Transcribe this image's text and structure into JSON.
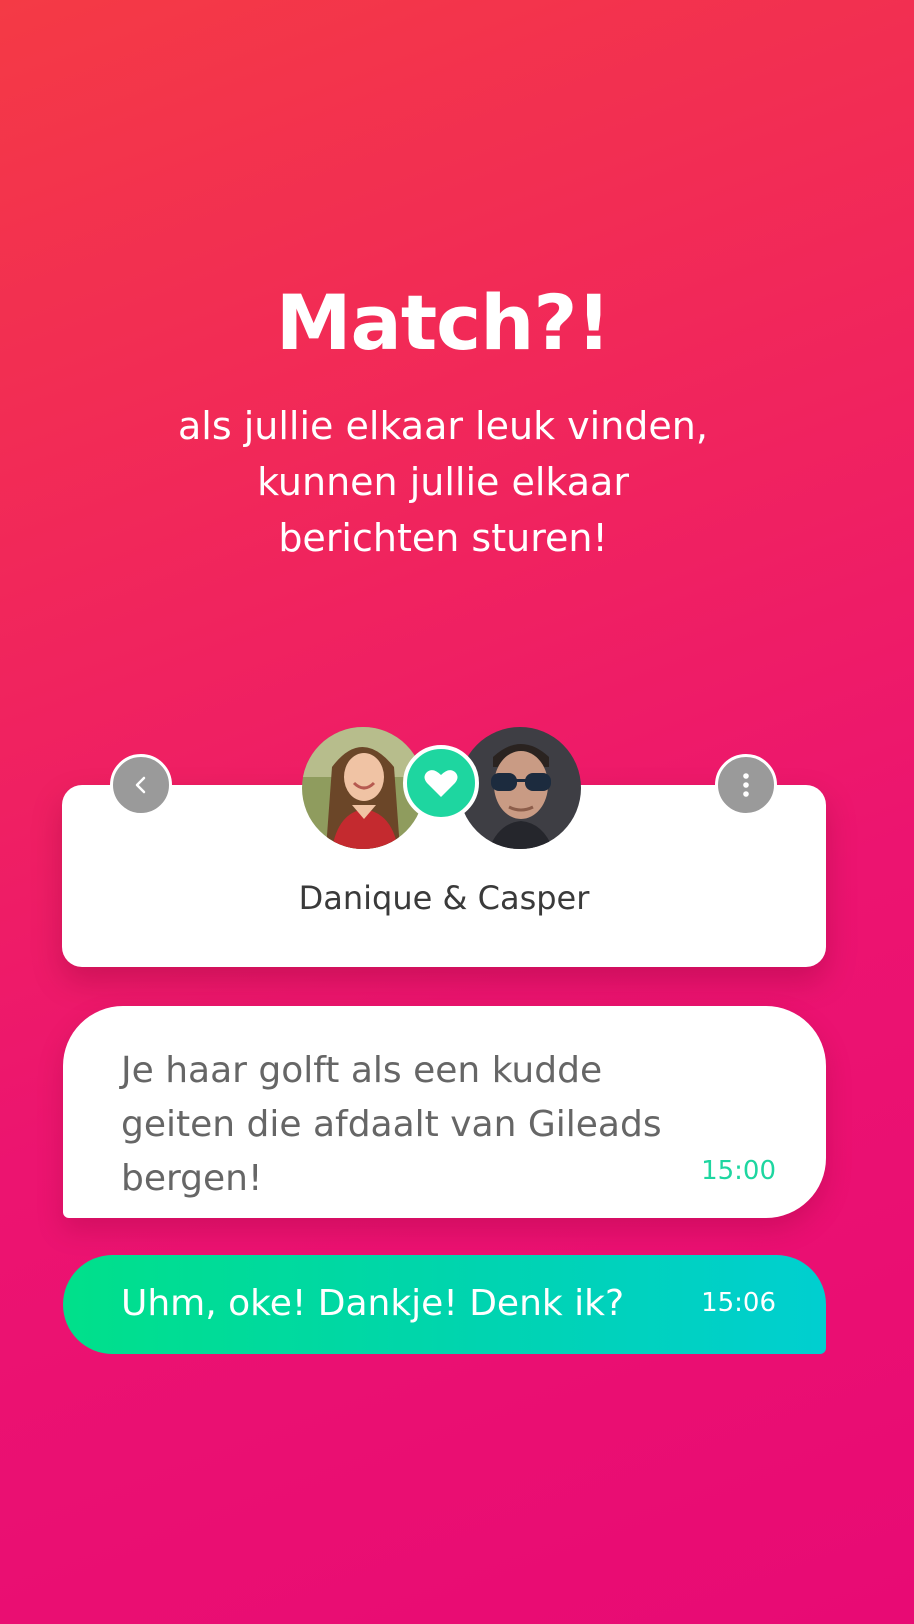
{
  "headline": "Match?!",
  "subtitle": "als jullie elkaar leuk vinden,\nkunnen jullie elkaar\nberichten sturen!",
  "match_card": {
    "names": "Danique & Casper"
  },
  "icons": {
    "back": "chevron-left-icon",
    "more": "more-vertical-icon",
    "match": "heart-icon"
  },
  "messages": [
    {
      "direction": "incoming",
      "text": "Je haar golft als een kudde geiten die afdaalt van Gileads bergen!",
      "time": "15:00"
    },
    {
      "direction": "outgoing",
      "text": "Uhm, oke! Dankje! Denk ik?",
      "time": "15:06"
    }
  ],
  "colors": {
    "background_top": "#f43a45",
    "background_bottom": "#e80a74",
    "accent": "#1ed6a0",
    "outgoing_start": "#00e08a",
    "outgoing_end": "#00cfd0",
    "button_grey": "#9a9a9a"
  }
}
